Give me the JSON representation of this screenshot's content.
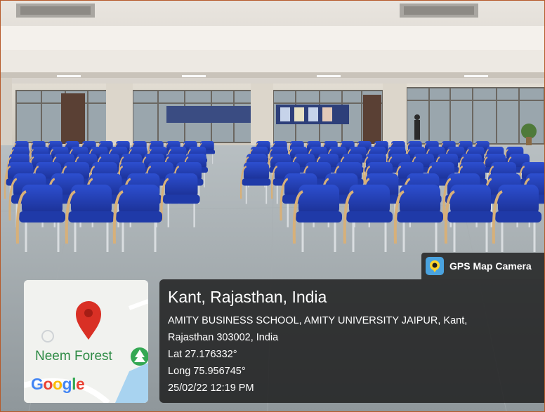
{
  "gps_tag": {
    "label": "GPS Map Camera",
    "icon": "gps-map-camera-app-icon"
  },
  "map": {
    "place_label": "Neem Forest",
    "logo_text": "Google",
    "logo_colors": [
      "#4285F4",
      "#EA4335",
      "#FBBC05",
      "#4285F4",
      "#34A853",
      "#EA4335"
    ],
    "pin_color": "#D93025",
    "park_icon_color": "#34A853"
  },
  "location": {
    "title": "Kant, Rajasthan, India",
    "address_line_1": "AMITY BUSINESS SCHOOL, AMITY UNIVERSITY JAIPUR, Kant,",
    "address_line_2": "Rajasthan 303002, India",
    "latitude": "Lat 27.176332°",
    "longitude": "Long 75.956745°",
    "datetime": "25/02/22 12:19 PM"
  },
  "colors": {
    "chair_blue": "#1f3aa8",
    "frame_border": "#b65a2a"
  }
}
